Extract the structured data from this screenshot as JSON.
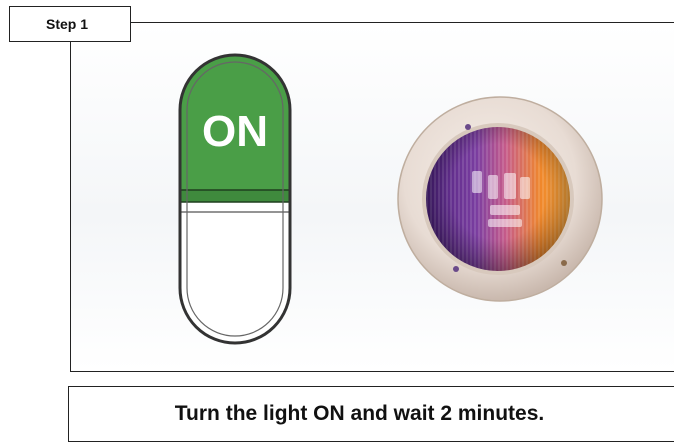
{
  "step": {
    "label": "Step 1"
  },
  "switch": {
    "state_label": "ON",
    "state": "on",
    "on_color": "#4a9e47",
    "off_color": "#ffffff"
  },
  "light": {
    "colors": [
      "#5b2a8f",
      "#c04a8a",
      "#f08a20"
    ],
    "rim_color": "#e8dcd4"
  },
  "instruction": {
    "text": "Turn the light ON and wait 2 minutes."
  }
}
